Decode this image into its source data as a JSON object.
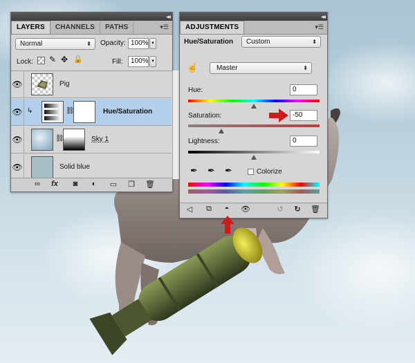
{
  "layers_panel": {
    "tabs": [
      "LAYERS",
      "CHANNELS",
      "PATHS"
    ],
    "blend_mode": "Normal",
    "opacity_label": "Opacity:",
    "opacity_value": "100%",
    "lock_label": "Lock:",
    "fill_label": "Fill:",
    "fill_value": "100%",
    "layers": [
      {
        "name": "Pig",
        "selected": false
      },
      {
        "name": "Hue/Saturation",
        "selected": true
      },
      {
        "name": "Sky 1",
        "selected": false
      },
      {
        "name": "Solid blue",
        "selected": false
      }
    ],
    "bottom_icons": [
      "link-icon",
      "fx-icon",
      "mask-icon",
      "adjustment-icon",
      "folder-icon",
      "new-layer-icon",
      "trash-icon"
    ],
    "fx_label": "fx"
  },
  "adjustments_panel": {
    "tab": "ADJUSTMENTS",
    "type_label": "Hue/Saturation",
    "preset": "Custom",
    "channel": "Master",
    "hue": {
      "label": "Hue:",
      "value": "0",
      "position": 0.5
    },
    "saturation": {
      "label": "Saturation:",
      "value": "-50",
      "position": 0.25
    },
    "lightness": {
      "label": "Lightness:",
      "value": "0",
      "position": 0.5
    },
    "colorize_label": "Colorize",
    "colorize_checked": false,
    "bottom_icons": [
      "back-arrow-icon",
      "clip-icon",
      "visibility-toggle-icon",
      "eye-icon",
      "previous-state-icon",
      "reset-icon",
      "trash-icon"
    ]
  },
  "colors": {
    "arrow_red": "#d11a1a",
    "selected_row": "#b4cfea",
    "solid_blue": "#a7bec6"
  }
}
